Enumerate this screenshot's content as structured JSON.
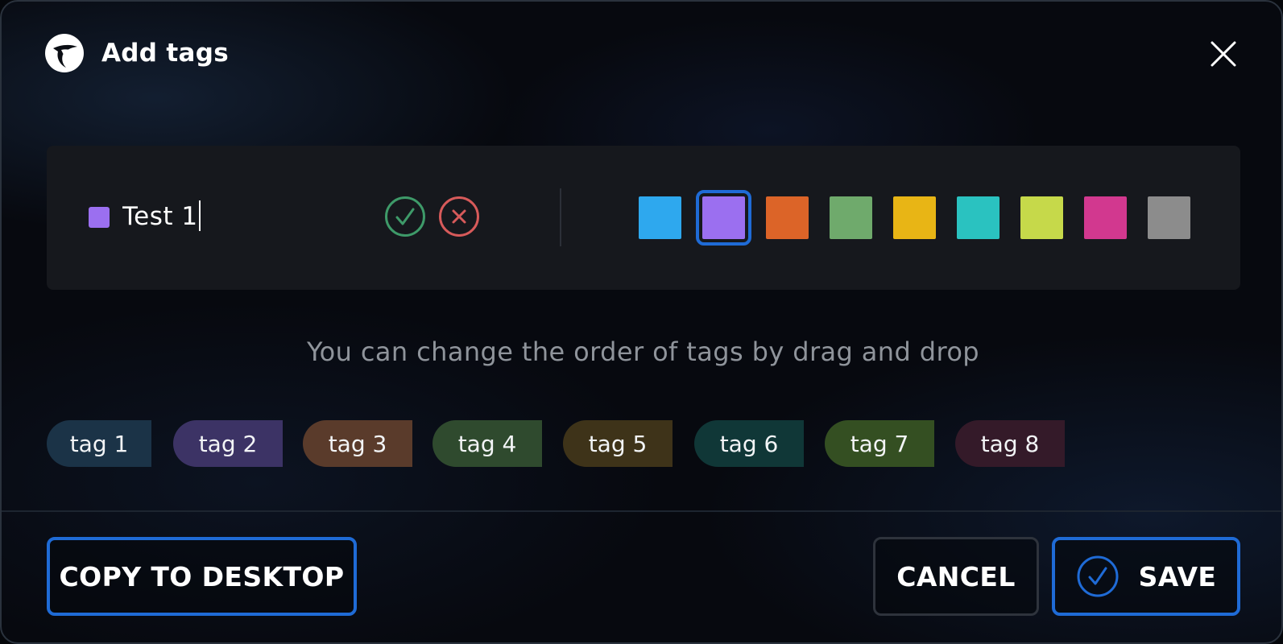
{
  "dialog": {
    "title": "Add tags",
    "logo_icon": "app-logo-icon",
    "close_icon": "close-icon"
  },
  "editor": {
    "input_value": "Test 1",
    "current_color": "#9b6ff0",
    "confirm_icon": "check-circle-icon",
    "cancel_icon": "x-circle-icon",
    "selected_color_index": 1,
    "colors": [
      {
        "name": "blue",
        "hex": "#2ea8ee"
      },
      {
        "name": "purple",
        "hex": "#9b6ff0"
      },
      {
        "name": "orange",
        "hex": "#dc6428"
      },
      {
        "name": "green",
        "hex": "#6faa6c"
      },
      {
        "name": "yellow",
        "hex": "#e8b515"
      },
      {
        "name": "teal",
        "hex": "#2ac2c0"
      },
      {
        "name": "lime",
        "hex": "#c6d94a"
      },
      {
        "name": "pink",
        "hex": "#d2388f"
      },
      {
        "name": "grey",
        "hex": "#8c8c8c"
      }
    ]
  },
  "hint": "You can change the order of tags by drag and drop",
  "tags": [
    {
      "label": "tag 1",
      "bg": "#1b3347"
    },
    {
      "label": "tag 2",
      "bg": "#3c3365"
    },
    {
      "label": "tag 3",
      "bg": "#5a3b2b"
    },
    {
      "label": "tag 4",
      "bg": "#2f4a2e"
    },
    {
      "label": "tag 5",
      "bg": "#3e3319"
    },
    {
      "label": "tag 6",
      "bg": "#103737"
    },
    {
      "label": "tag 7",
      "bg": "#344f22"
    },
    {
      "label": "tag 8",
      "bg": "#341a29"
    }
  ],
  "footer": {
    "copy_label": "COPY TO DESKTOP",
    "cancel_label": "CANCEL",
    "save_label": "SAVE",
    "save_icon": "check-circle-icon"
  },
  "accent_color": "#1f6bd6"
}
